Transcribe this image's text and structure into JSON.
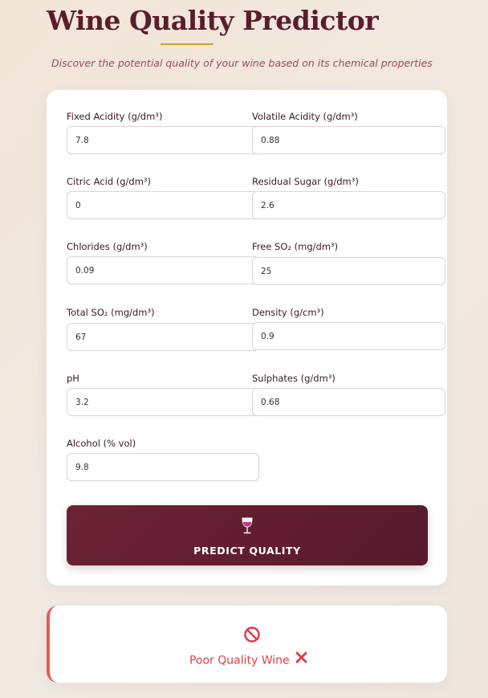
{
  "header": {
    "title": "Wine Quality Predictor",
    "subtitle": "Discover the potential quality of your wine based on its chemical properties"
  },
  "form": {
    "fixed_acidity": {
      "label": "Fixed Acidity (g/dm³)",
      "value": "7.8"
    },
    "volatile_acidity": {
      "label": "Volatile Acidity (g/dm³)",
      "value": "0.88"
    },
    "citric_acid": {
      "label": "Citric Acid (g/dm³)",
      "value": "0"
    },
    "residual_sugar": {
      "label": "Residual Sugar (g/dm³)",
      "value": "2.6"
    },
    "chlorides": {
      "label": "Chlorides (g/dm³)",
      "value": "0.09"
    },
    "free_so2": {
      "label": "Free SO₂ (mg/dm³)",
      "value": "25"
    },
    "total_so2": {
      "label": "Total SO₂ (mg/dm³)",
      "value": "67"
    },
    "density": {
      "label": "Density (g/cm³)",
      "value": "0.9"
    },
    "ph": {
      "label": "pH",
      "value": "3.2"
    },
    "sulphates": {
      "label": "Sulphates (g/dm³)",
      "value": "0.68"
    },
    "alcohol": {
      "label": "Alcohol (% vol)",
      "value": "9.8"
    }
  },
  "predict_button": {
    "label": "PREDICT QUALITY",
    "icon": "wine-glass-icon"
  },
  "result": {
    "text": "Poor Quality Wine",
    "icon": "prohibited-icon",
    "suffix_icon": "cross-mark-icon"
  },
  "colors": {
    "brand": "#5a1d2b",
    "accent_gold": "#c9a227",
    "button": "#6d2234",
    "error": "#e35d4f"
  }
}
